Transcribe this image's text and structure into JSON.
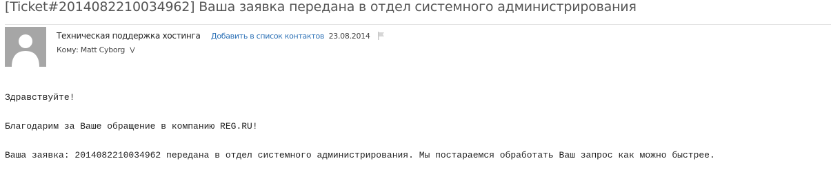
{
  "email": {
    "subject": "[Ticket#2014082210034962] Ваша заявка передана в отдел системного администрирования",
    "sender": {
      "name": "Техническая поддержка хостинга",
      "add_contact_label": "Добавить в список контактов",
      "date": "23.08.2014"
    },
    "recipient_line": "Кому: Matt Cyborg",
    "body": {
      "greeting": "Здравствуйте!",
      "thanks": "Благодарим за Ваше обращение в компанию REG.RU!",
      "ticket_info": "Ваша заявка: 2014082210034962 передана в отдел системного администрирования. Мы постараемся обработать Ваш запрос как можно быстрее."
    }
  },
  "icons": {
    "avatar": "avatar-placeholder-icon",
    "flag": "flag-icon",
    "expand": "chevron-down-icon"
  },
  "colors": {
    "link": "#2a6fb5",
    "avatar_bg": "#a6a6a6",
    "avatar_fg": "#ffffff",
    "flag": "#c8c8c8"
  }
}
